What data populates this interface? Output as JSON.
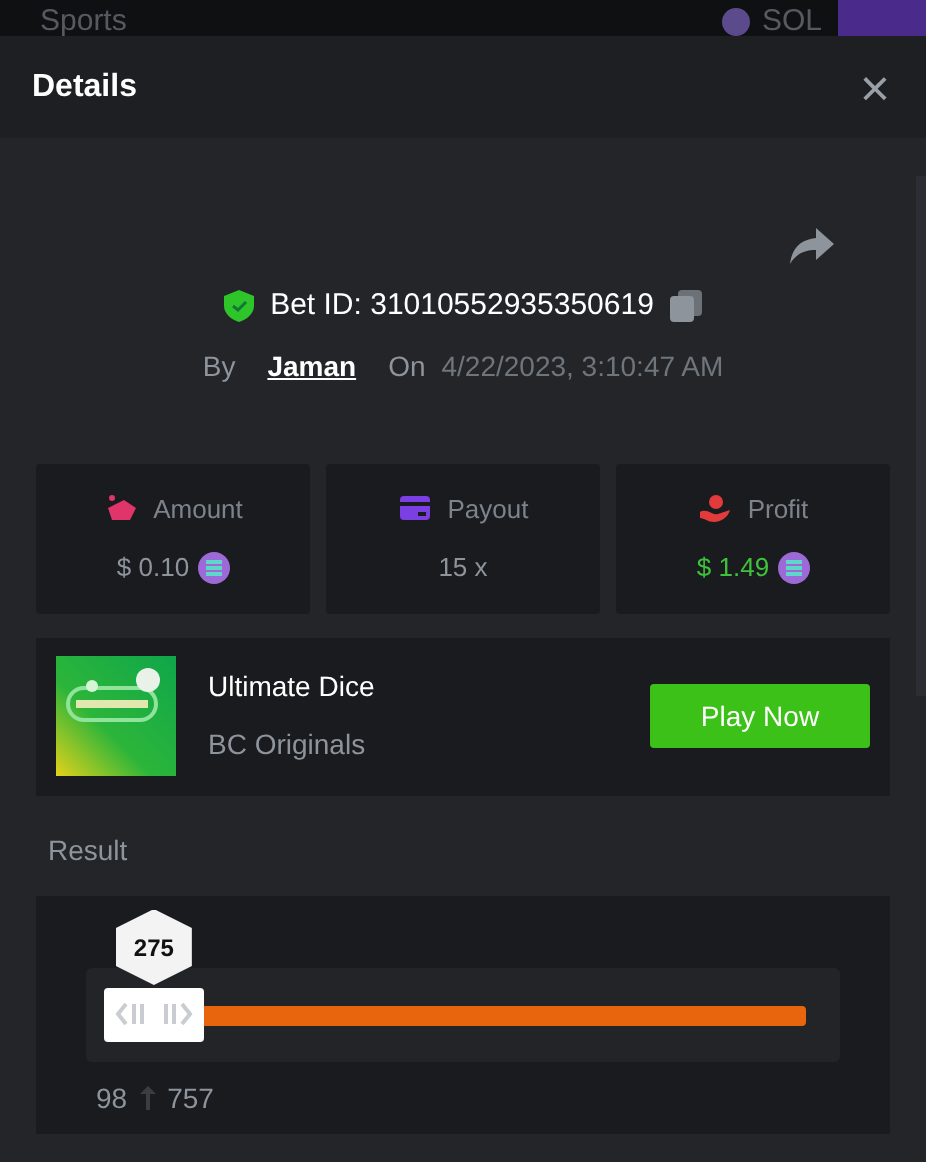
{
  "backdrop": {
    "nav_item": "Sports",
    "currency": "SOL"
  },
  "dialog": {
    "title": "Details",
    "close": "×"
  },
  "bet": {
    "id_label": "Bet ID: 31010552935350619",
    "by_label": "By",
    "user": "Jaman",
    "on_label": "On",
    "time": "4/22/2023, 3:10:47 AM"
  },
  "stats": [
    {
      "kind": "amount",
      "label": "Amount",
      "value": "$ 0.10",
      "coin": true,
      "color": "#e0356b"
    },
    {
      "kind": "payout",
      "label": "Payout",
      "value": "15 x",
      "coin": false,
      "color": "#7b3fe4"
    },
    {
      "kind": "profit",
      "label": "Profit",
      "value": "$ 1.49",
      "coin": true,
      "color": "#e33b3b"
    }
  ],
  "game": {
    "name": "Ultimate Dice",
    "provider": "BC Originals",
    "button": "Play Now"
  },
  "result": {
    "title": "Result",
    "value": "275",
    "level": 0.09,
    "low": "98",
    "high": "757"
  }
}
